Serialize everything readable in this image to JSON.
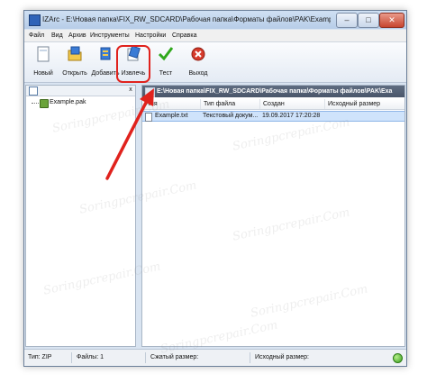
{
  "window": {
    "title": "IZArc - E:\\Новая папка\\FIX_RW_SDCARD\\Рабочая папка\\Форматы файлов\\PAK\\Example.pak",
    "buttons": {
      "minimize": "–",
      "maximize": "□",
      "close": "✕"
    }
  },
  "menu": [
    "Файл",
    "Вид",
    "Архив",
    "Инструменты",
    "Настройки",
    "Справка"
  ],
  "toolbar": [
    {
      "label": "Новый",
      "icon": "new-archive-icon"
    },
    {
      "label": "Открыть",
      "icon": "open-folder-icon"
    },
    {
      "label": "Добавить",
      "icon": "add-files-icon"
    },
    {
      "label": "Извлечь",
      "icon": "extract-icon"
    },
    {
      "label": "Тест",
      "icon": "checkmark-icon"
    },
    {
      "label": "Выход",
      "icon": "exit-icon"
    }
  ],
  "tree": {
    "close_label": "x",
    "items": [
      {
        "label": "Example.pak"
      }
    ]
  },
  "path": "E:\\Новая папка\\FIX_RW_SDCARD\\Рабочая папка\\Форматы файлов\\PAK\\Exa",
  "columns": [
    "Имя",
    "Тип файла",
    "Создан",
    "Исходный размер"
  ],
  "files": [
    {
      "name": "Example.txt",
      "type": "Текстовый докум...",
      "created": "19.09.2017 17:20:28",
      "size": ""
    }
  ],
  "status": {
    "type": "Тип: ZIP",
    "files": "Файлы: 1",
    "compressed": "Сжатый размер:",
    "original": "Исходный размер:"
  },
  "watermark_text": "Soringpcrepair.Com",
  "colors": {
    "highlight": "#e0221d",
    "accent": "#2f63b8",
    "pathbar": "#4a566a"
  }
}
